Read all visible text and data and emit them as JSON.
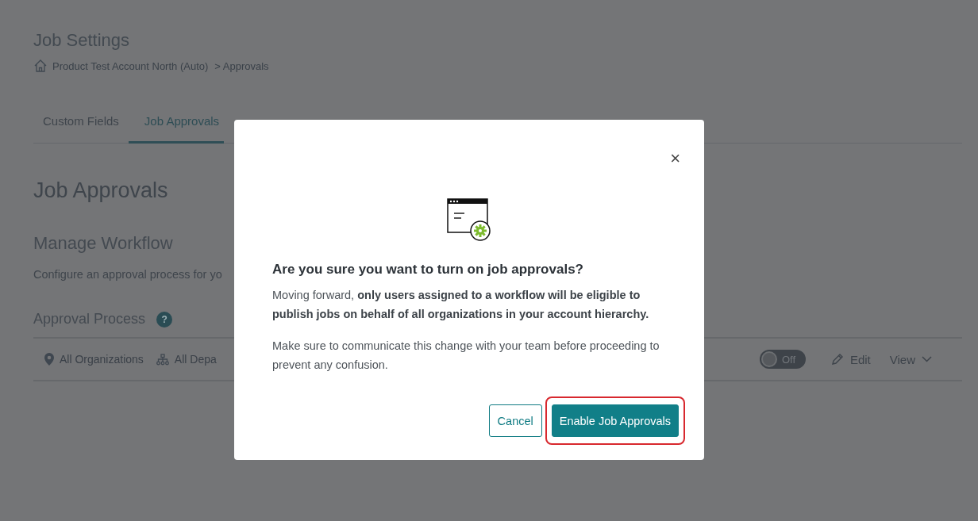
{
  "page": {
    "title": "Job Settings",
    "breadcrumb": [
      {
        "label": "Product Test Account North (Auto)",
        "kind": "home"
      },
      {
        "label": "> Approvals",
        "kind": "plain"
      }
    ],
    "tabs": [
      {
        "label": "Custom Fields",
        "selected": false
      },
      {
        "label": "Job Approvals",
        "selected": true
      }
    ],
    "heading": "Job Approvals",
    "section_title": "Manage Workflow",
    "section_text": "Configure an approval process for yo",
    "approval_process": {
      "title": "Approval Process",
      "help": "?",
      "filters": [
        {
          "label": "All Organizations",
          "kind": "location"
        },
        {
          "label": "All Depa",
          "kind": "hierarchy"
        }
      ],
      "toggle": {
        "on": false,
        "label": "Off"
      },
      "edit": "Edit",
      "view": "View"
    }
  },
  "dialog": {
    "close": "×",
    "title": "Are you sure you want to turn on job approvals?",
    "paragraphs": [
      "Moving forward, **only users assigned to a workflow will be eligible to publish jobs on behalf of all organizations in your account hierarchy.**",
      "Make sure to communicate this change with your team before proceeding to prevent any confusion."
    ],
    "buttons": [
      {
        "label": "Cancel",
        "kind": "secondary",
        "highlighted": false
      },
      {
        "label": "Enable Job Approvals",
        "kind": "primary",
        "highlighted": true
      }
    ]
  }
}
